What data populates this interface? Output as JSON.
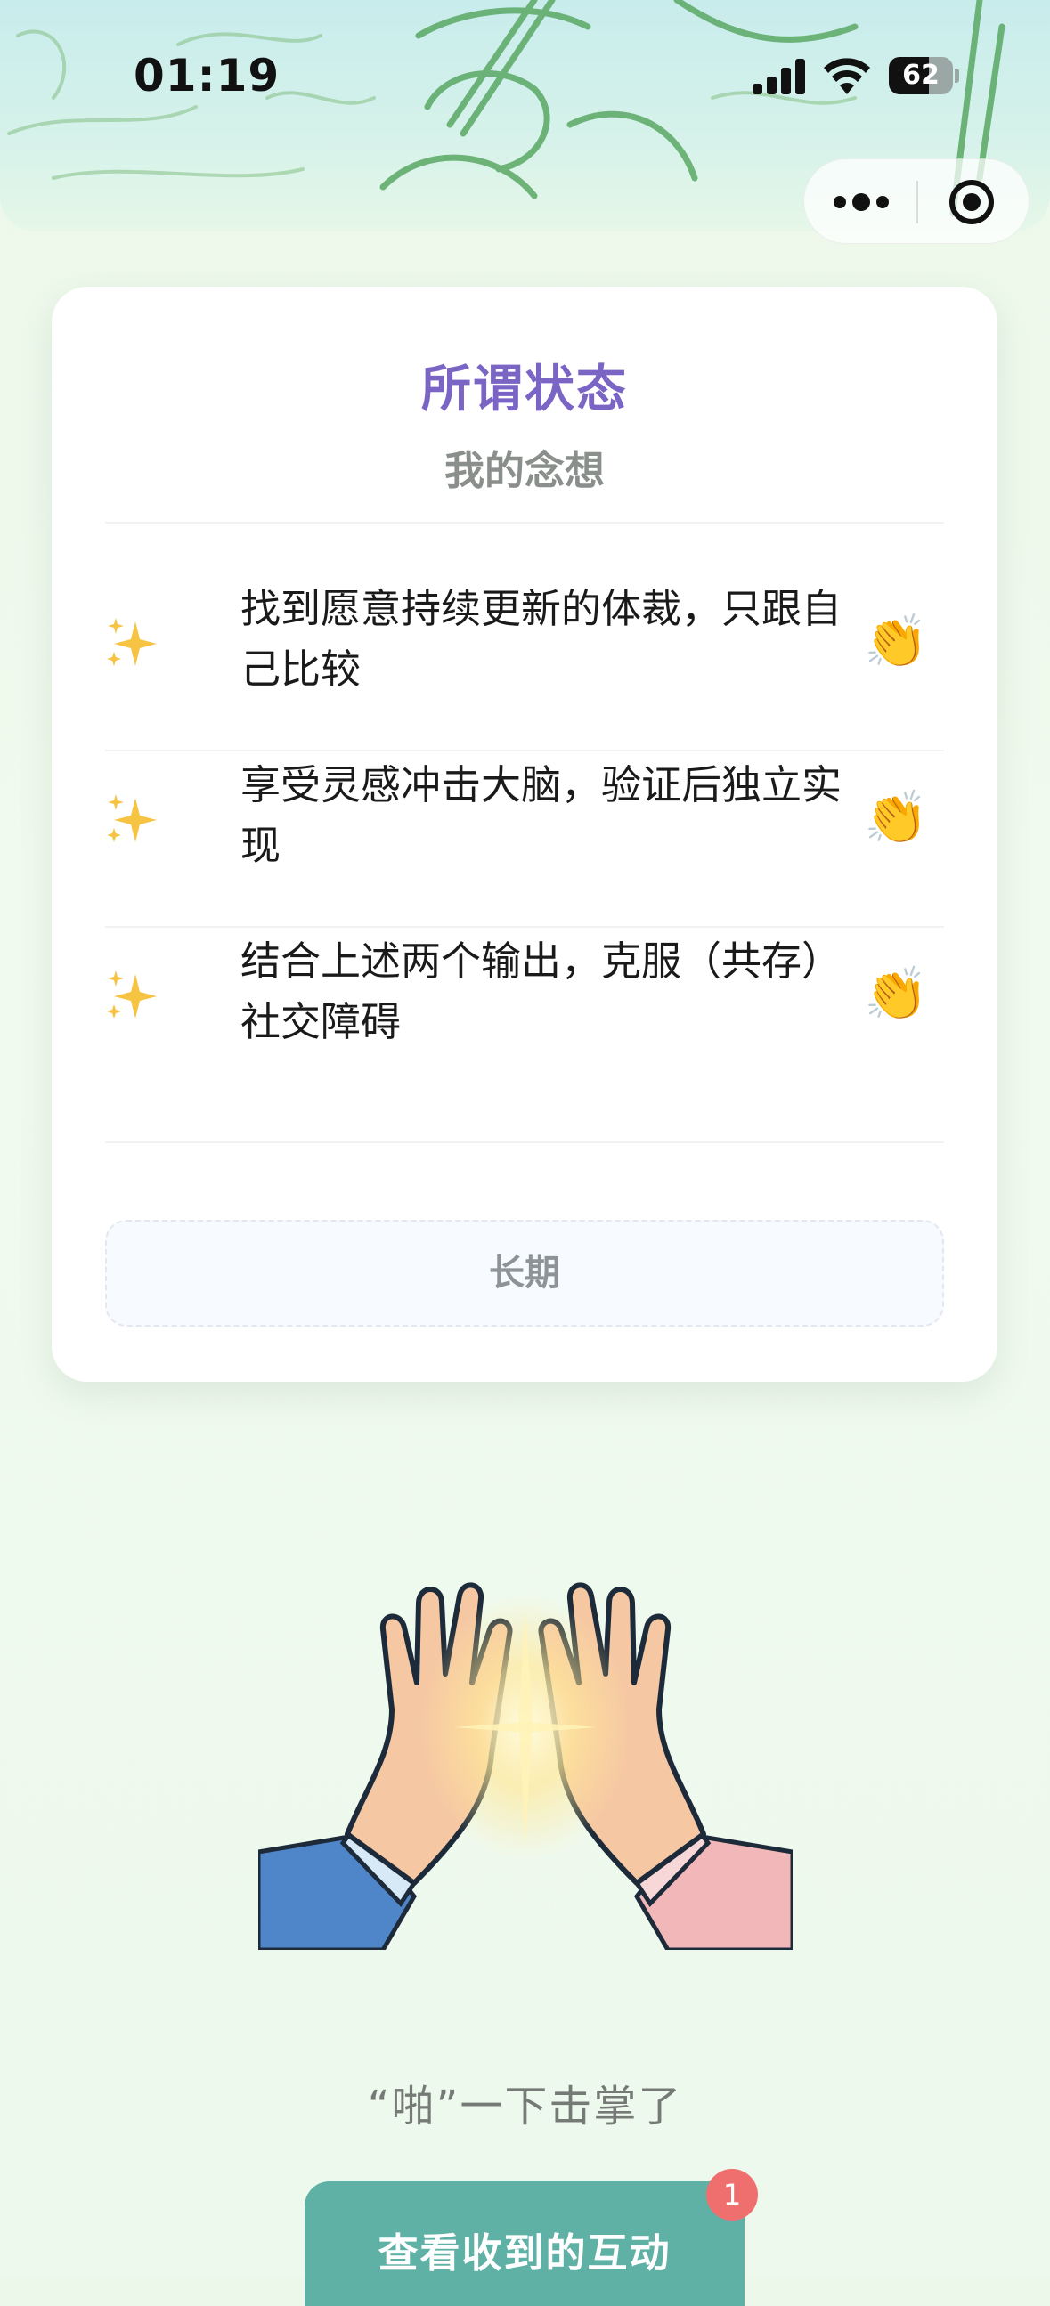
{
  "status_bar": {
    "time": "01:19",
    "battery": "62",
    "battery_level": 0.62
  },
  "capsule": {
    "more_icon": "more-dots-icon",
    "close_icon": "target-close-icon"
  },
  "card": {
    "title": "所谓状态",
    "subtitle": "我的念想",
    "items": [
      {
        "icon": "sparkles-icon",
        "text": "找到愿意持续更新的体裁，只跟自己比较",
        "reaction": "👏"
      },
      {
        "icon": "sparkles-icon",
        "text": "享受灵感冲击大脑，验证后独立实现",
        "reaction": "👏"
      },
      {
        "icon": "sparkles-icon",
        "text": "结合上述两个输出，克服（共存）社交障碍",
        "reaction": "👏"
      }
    ],
    "period": "长期"
  },
  "illustration": {
    "icon": "high-five-icon"
  },
  "caption": "“啪”一下击掌了",
  "button": {
    "label": "查看收到的互动",
    "badge": "1"
  },
  "colors": {
    "title": "#7a64c4",
    "button": "#5fb0a5",
    "badge": "#ef6f6f",
    "sketch": "#4a9a55"
  }
}
